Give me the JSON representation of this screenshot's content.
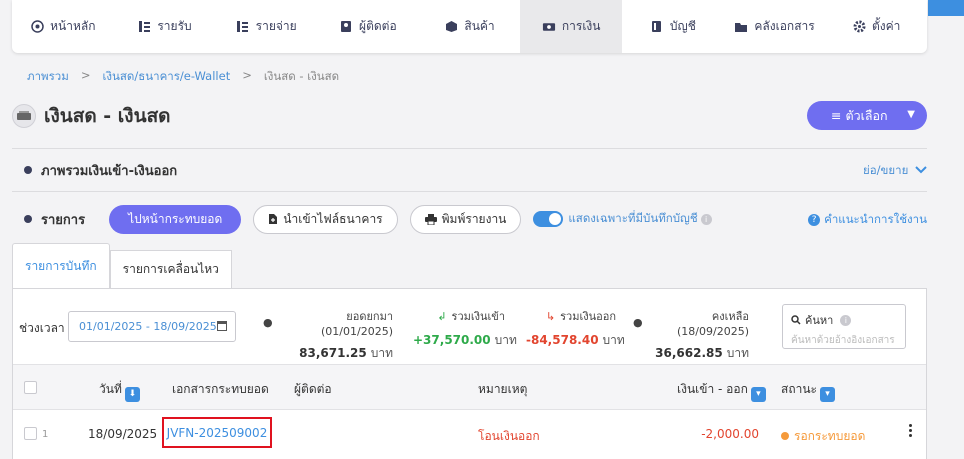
{
  "nav": {
    "items": [
      {
        "label": "หน้าหลัก",
        "icon": "home-icon"
      },
      {
        "label": "รายรับ",
        "icon": "income-icon"
      },
      {
        "label": "รายจ่าย",
        "icon": "expense-icon"
      },
      {
        "label": "ผู้ติดต่อ",
        "icon": "contacts-icon"
      },
      {
        "label": "สินค้า",
        "icon": "product-icon"
      },
      {
        "label": "การเงิน",
        "icon": "money-icon",
        "active": true
      },
      {
        "label": "บัญชี",
        "icon": "accounting-icon"
      },
      {
        "label": "คลังเอกสาร",
        "icon": "folder-icon"
      },
      {
        "label": "ตั้งค่า",
        "icon": "gear-icon"
      }
    ]
  },
  "breadcrumb": {
    "items": [
      "ภาพรวม",
      "เงินสด/ธนาคาร/e-Wallet",
      "เงินสด - เงินสด"
    ],
    "sep": ">"
  },
  "page": {
    "title": "เงินสด - เงินสด",
    "options_label": "≡ ตัวเลือก"
  },
  "overview": {
    "title": "ภาพรวมเงินเข้า-เงินออก",
    "toggle_label": "ย่อ/ขยาย"
  },
  "list": {
    "title": "รายการ",
    "reconcile_button": "ไปหน้ากระทบยอด",
    "import_button": "นำเข้าไฟล์ธนาคาร",
    "print_button": "พิมพ์รายงาน",
    "switch_label": "แสดงเฉพาะที่มีบันทึกบัญชี",
    "switch_on": true,
    "help_label": "คำแนะนำการใช้งาน"
  },
  "tabs": [
    {
      "label": "รายการบันทึก",
      "active": true
    },
    {
      "label": "รายการเคลื่อนไหว",
      "active": false
    }
  ],
  "filter": {
    "period_label": "ช่วงเวลา",
    "date_range": "01/01/2025 - 18/09/2025"
  },
  "stats": {
    "brought_forward": {
      "label": "ยอดยกมา (01/01/2025)",
      "value": "83,671.25",
      "unit": "บาท"
    },
    "total_in": {
      "label": "รวมเงินเข้า",
      "value": "+37,570.00",
      "unit": "บาท"
    },
    "total_out": {
      "label": "รวมเงินออก",
      "value": "-84,578.40",
      "unit": "บาท"
    },
    "balance": {
      "label": "คงเหลือ (18/09/2025)",
      "value": "36,662.85",
      "unit": "บาท"
    }
  },
  "search": {
    "label": "ค้นหา",
    "placeholder": "ค้นหาด้วยอ้างอิงเอกสาร"
  },
  "table": {
    "headers": {
      "date": "วันที่",
      "doc": "เอกสารกระทบยอด",
      "contact": "ผู้ติดต่อ",
      "note": "หมายเหตุ",
      "amount": "เงินเข้า - ออก",
      "status": "สถานะ"
    },
    "rows": [
      {
        "index": "1",
        "date": "18/09/2025",
        "doc": "JVFN-202509002",
        "contact": "",
        "note": "โอนเงินออก",
        "amount": "-2,000.00",
        "status": "รอกระทบยอด"
      }
    ]
  },
  "colors": {
    "accent": "#6f6ef0",
    "link": "#3d8fe0",
    "income": "#2eaa4a",
    "expense": "#e2452f",
    "pending": "#f59a3b",
    "highlight_box": "#e0121f"
  }
}
